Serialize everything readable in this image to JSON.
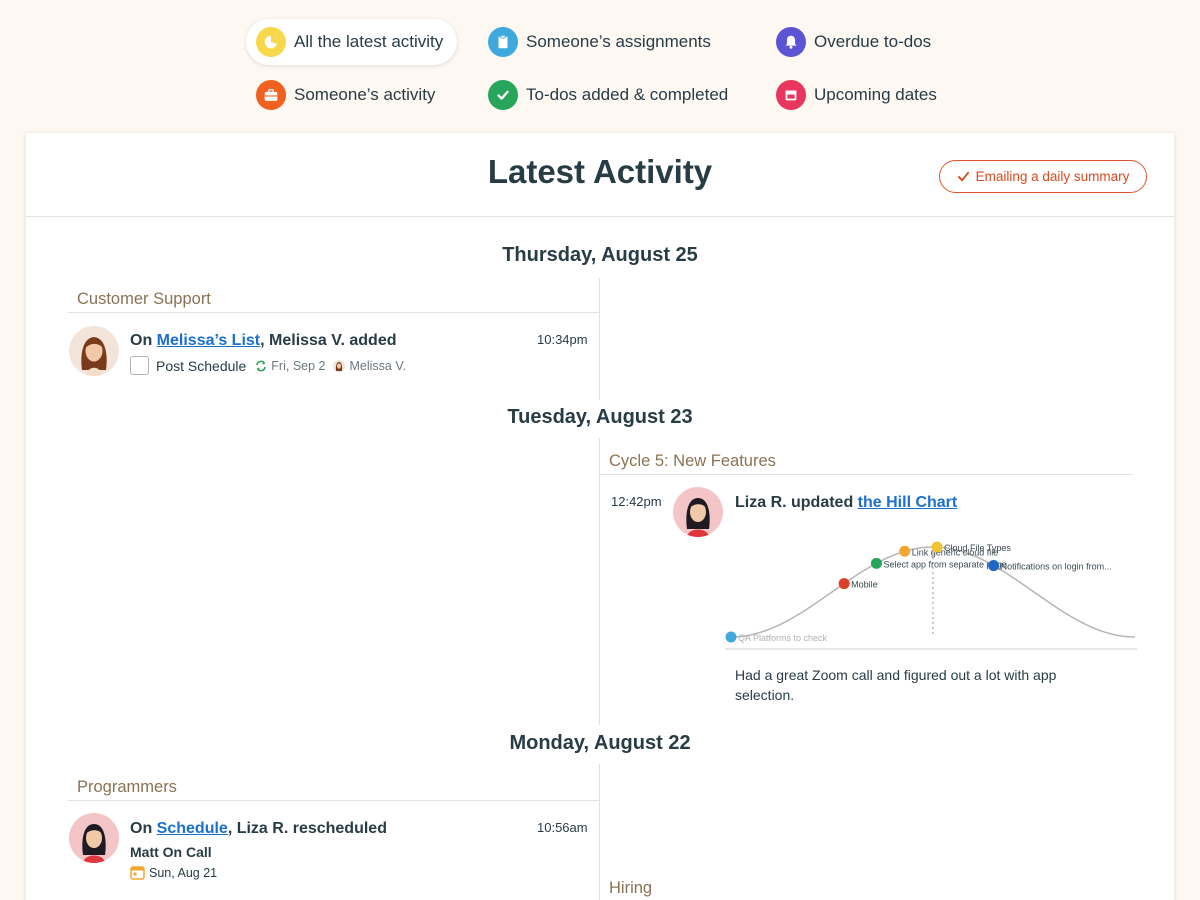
{
  "filters": [
    {
      "label": "All the latest activity",
      "icon": "pie-clock-icon",
      "color": "#f6d84a"
    },
    {
      "label": "Someone’s assignments",
      "icon": "clipboard-icon",
      "color": "#3fa9de"
    },
    {
      "label": "Overdue to-dos",
      "icon": "bell-icon",
      "color": "#5b55d6"
    },
    {
      "label": "Someone’s activity",
      "icon": "briefcase-icon",
      "color": "#f0601e"
    },
    {
      "label": "To-dos added & completed",
      "icon": "checkmark-icon",
      "color": "#27a55a"
    },
    {
      "label": "Upcoming dates",
      "icon": "calendar-icon",
      "color": "#e8365e"
    }
  ],
  "page": {
    "title": "Latest Activity",
    "email_button": "Emailing a daily summary"
  },
  "days": [
    {
      "label": "Thursday, August 25"
    },
    {
      "label": "Tuesday, August 23"
    },
    {
      "label": "Monday, August 22"
    }
  ],
  "events": {
    "e1": {
      "bucket": "Customer Support",
      "prefix": "On ",
      "link": "Melissa’s List",
      "suffix": ", Melissa V. added",
      "time": "10:34pm",
      "todo": "Post Schedule",
      "due": "Fri, Sep 2",
      "assignee": "Melissa V."
    },
    "e2": {
      "bucket": "Cycle 5: New Features",
      "time": "12:42pm",
      "prefix": "Liza R. updated ",
      "link": "the Hill Chart",
      "note": "Had a great Zoom call and figured out a lot with app selection.",
      "hill_points": [
        {
          "label": "QA Platforms to check",
          "color": "#3fa9de",
          "progress": 0
        },
        {
          "label": "Mobile",
          "color": "#d9402a",
          "progress": 0.28
        },
        {
          "label": "Select app from separate page",
          "color": "#27a55a",
          "progress": 0.36
        },
        {
          "label": "Link generic cloud file",
          "color": "#f5a632",
          "progress": 0.43
        },
        {
          "label": "Cloud File Types",
          "color": "#f2c230",
          "progress": 0.51
        },
        {
          "label": "Notifications on login from...",
          "color": "#1e67c8",
          "progress": 0.65
        }
      ]
    },
    "e3": {
      "bucket": "Programmers",
      "prefix": "On ",
      "link": "Schedule",
      "suffix": ", Liza R. rescheduled",
      "time": "10:56am",
      "item": "Matt On Call",
      "date": "Sun, Aug 21"
    },
    "e4": {
      "bucket": "Hiring"
    }
  }
}
